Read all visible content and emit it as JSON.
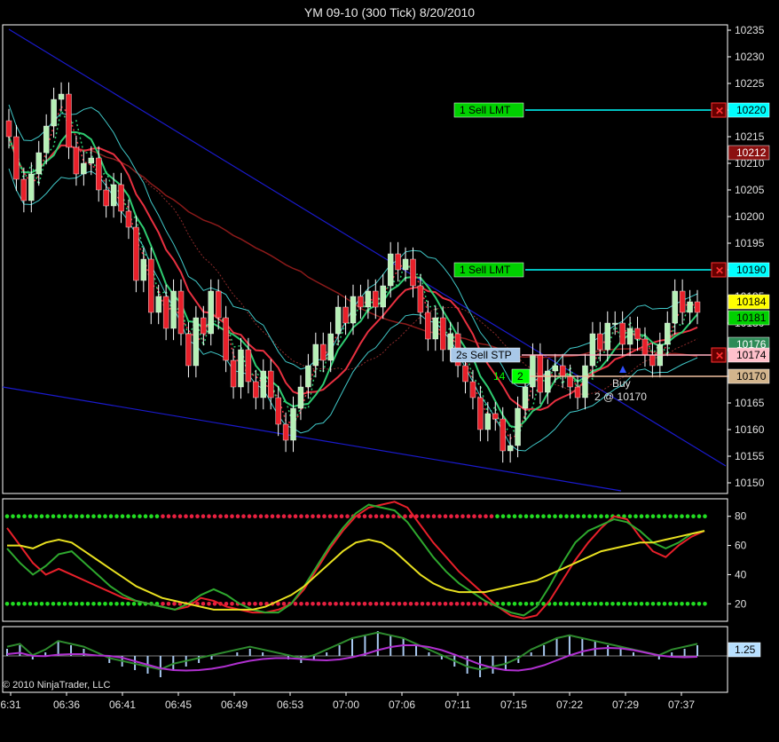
{
  "title": "YM 09-10 (300 Tick)  8/20/2010",
  "copyright": "© 2010 NinjaTrader, LLC",
  "colors": {
    "background": "#000000",
    "up_candle": "#b6f0b6",
    "down_candle": "#e8202a",
    "trendline": "#1a1acc",
    "cyan": "#00ffff",
    "green_order": "#00d000",
    "stop_order": "#a8c8e8",
    "buy_line": "#f0c0a0"
  },
  "chart_data": [
    {
      "type": "candlestick",
      "title": "YM 09-10 (300 Tick)  8/20/2010",
      "x_tick_labels": [
        "6:31",
        "06:36",
        "06:41",
        "06:45",
        "06:49",
        "06:53",
        "07:00",
        "07:06",
        "07:11",
        "07:15",
        "07:22",
        "07:29",
        "07:37"
      ],
      "y_tick_labels": [
        10150,
        10155,
        10160,
        10165,
        10170,
        10175,
        10180,
        10185,
        10190,
        10195,
        10200,
        10205,
        10210,
        10215,
        10220,
        10225,
        10230,
        10235
      ],
      "ylim": [
        10148,
        10236
      ],
      "candles_close": [
        10215,
        10207,
        10203,
        10208,
        10212,
        10217,
        10222,
        10223,
        10213,
        10208,
        10210,
        10211,
        10205,
        10202,
        10206,
        10201,
        10198,
        10188,
        10192,
        10182,
        10185,
        10179,
        10186,
        10178,
        10172,
        10181,
        10178,
        10186,
        10181,
        10173,
        10168,
        10175,
        10169,
        10166,
        10171,
        10166,
        10161,
        10158,
        10164,
        10168,
        10172,
        10176,
        10173,
        10178,
        10183,
        10180,
        10185,
        10183,
        10186,
        10183,
        10187,
        10193,
        10190,
        10192,
        10187,
        10182,
        10177,
        10181,
        10175,
        10178,
        10172,
        10169,
        10166,
        10160,
        10163,
        10162,
        10156,
        10157,
        10164,
        10168,
        10174,
        10167,
        10171,
        10172,
        10170,
        10168,
        10166,
        10172,
        10178,
        10175,
        10180,
        10180,
        10176,
        10179,
        10177,
        10174,
        10172,
        10176,
        10180,
        10186,
        10182,
        10184,
        10182
      ],
      "price_labels": [
        {
          "value": 10220,
          "text": "10220",
          "color": "#00ffff"
        },
        {
          "value": 10212,
          "text": "10212",
          "color": "#8b1010"
        },
        {
          "value": 10190,
          "text": "10190",
          "color": "#00ffff"
        },
        {
          "value": 10184,
          "text": "10184",
          "color": "#ffff00"
        },
        {
          "value": 10181,
          "text": "10181",
          "color": "#00d000"
        },
        {
          "value": 10176,
          "text": "10176",
          "color": "#2e8b57"
        },
        {
          "value": 10174,
          "text": "10174",
          "color": "#ffc0cb"
        },
        {
          "value": 10170,
          "text": "10170",
          "color": "#d2b48c"
        }
      ],
      "orders": [
        {
          "label": "1   Sell LMT",
          "price": 10220,
          "qty_color": "#00d000"
        },
        {
          "label": "1   Sell LMT",
          "price": 10190,
          "qty_color": "#00d000"
        },
        {
          "label": "2s   Sell STP",
          "price": 10174,
          "qty_color": "#a8c8e8"
        }
      ],
      "position": {
        "qty_label": "2",
        "pnl_label": "14",
        "price": 10170
      },
      "execution": {
        "side_label": "Buy",
        "fill_label": "2 @ 10170"
      }
    },
    {
      "type": "line",
      "name": "oscillator",
      "y_tick_labels": [
        20,
        40,
        60,
        80
      ],
      "ylim": [
        8,
        92
      ],
      "series": [
        {
          "color": "#e8202a",
          "values": [
            72,
            60,
            48,
            40,
            44,
            40,
            36,
            32,
            28,
            24,
            22,
            20,
            18,
            16,
            18,
            24,
            22,
            18,
            16,
            14,
            14,
            16,
            20,
            30,
            44,
            58,
            70,
            80,
            86,
            88,
            90,
            86,
            74,
            62,
            52,
            42,
            34,
            26,
            18,
            12,
            10,
            12,
            22,
            36,
            50,
            62,
            72,
            80,
            78,
            66,
            56,
            52,
            60,
            66,
            70
          ]
        },
        {
          "color": "#2ea82e",
          "values": [
            58,
            48,
            40,
            46,
            54,
            56,
            48,
            40,
            32,
            26,
            22,
            20,
            18,
            16,
            20,
            26,
            30,
            26,
            20,
            16,
            14,
            14,
            20,
            32,
            46,
            60,
            72,
            82,
            88,
            86,
            84,
            76,
            64,
            52,
            42,
            34,
            28,
            22,
            18,
            14,
            12,
            18,
            32,
            48,
            62,
            70,
            74,
            78,
            76,
            70,
            62,
            58,
            62,
            68,
            70
          ]
        },
        {
          "color": "#e8e020",
          "values": [
            60,
            60,
            58,
            62,
            64,
            62,
            56,
            50,
            44,
            38,
            32,
            28,
            24,
            22,
            20,
            18,
            16,
            16,
            16,
            16,
            18,
            22,
            26,
            32,
            40,
            48,
            56,
            62,
            64,
            62,
            56,
            48,
            40,
            34,
            30,
            28,
            28,
            28,
            30,
            32,
            34,
            36,
            40,
            44,
            48,
            52,
            56,
            58,
            60,
            62,
            62,
            64,
            66,
            68,
            70
          ]
        }
      ]
    },
    {
      "type": "bar",
      "name": "histogram",
      "value_label": "1.25",
      "values": [
        2,
        3,
        -1,
        1,
        4,
        3,
        2,
        0,
        -2,
        -3,
        -4,
        -5,
        -6,
        -4,
        -3,
        -2,
        -1,
        0,
        1,
        2,
        1,
        0,
        -1,
        -2,
        -1,
        1,
        3,
        5,
        6,
        7,
        6,
        5,
        3,
        1,
        -1,
        -3,
        -5,
        -6,
        -5,
        -4,
        -2,
        1,
        3,
        5,
        6,
        5,
        4,
        3,
        2,
        1,
        0,
        -1,
        1,
        2,
        3
      ]
    }
  ]
}
